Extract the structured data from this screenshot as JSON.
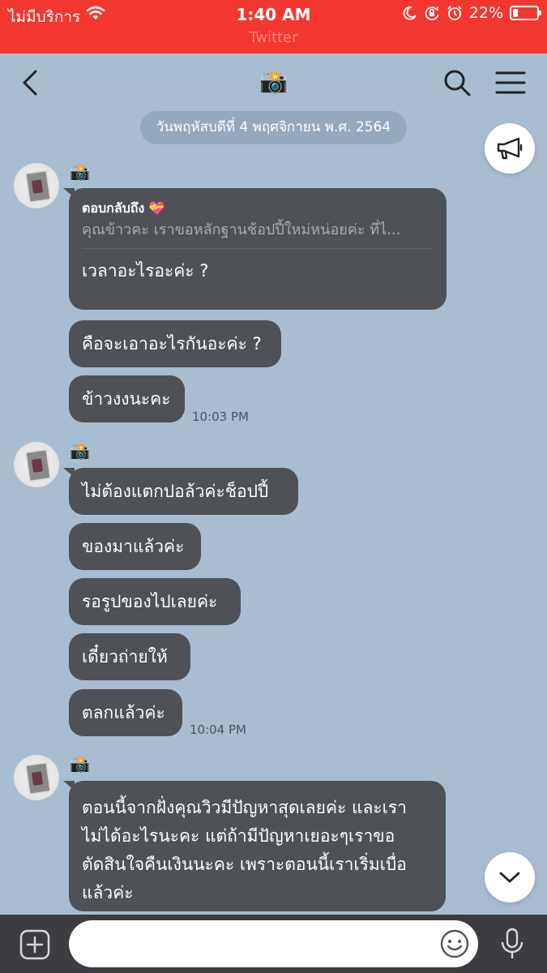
{
  "status_bar": {
    "carrier": "ไม่มีบริการ",
    "time": "1:40 AM",
    "battery_percent": "22%",
    "battery_level": 0.22,
    "back_to_app": "Twitter",
    "icons": [
      "wifi-icon",
      "moon-icon",
      "orientation-lock-icon",
      "alarm-icon",
      "battery-icon"
    ]
  },
  "header": {
    "title": "📸",
    "icons": [
      "back-chevron-icon",
      "search-icon",
      "menu-icon"
    ]
  },
  "date_divider": "วันพฤหัสบดีที่ 4 พฤศจิกายน พ.ศ. 2564",
  "groups": [
    {
      "sender": "📸",
      "reply": {
        "label": "ตอบกลับถึง 💝",
        "quote": "คุณข้าวคะ เราขอหลักฐานช้อปปี้ใหม่หน่อยค่ะ ที่ไ..."
      },
      "messages": [
        "เวลาอะไรอะค่ะ ?",
        "คือจะเอาอะไรกันอะค่ะ ?",
        "ข้าวงงนะคะ"
      ],
      "time": "10:03 PM"
    },
    {
      "sender": "📸",
      "messages": [
        "ไม่ต้องแตกปอล้วค่ะช็อปปี้",
        "ของมาแล้วค่ะ",
        "รอรูปของไปเลยค่ะ",
        "เดี๋ยวถ่ายให้",
        "ตลกแล้วค่ะ"
      ],
      "time": "10:04 PM"
    },
    {
      "sender": "📸",
      "messages": [
        "ตอนนี้จากฝั่งคุณวิวมีปัญหาสุดเลยค่ะ และเรา",
        "ไม่ได้อะไรนะคะ แต่ถ้ามีปัญหาเยอะๆเราขอ",
        "ตัดสินใจคืนเงินนะคะ เพราะตอนนี้เราเริ่มเบื่อ",
        "แล้วค่ะ"
      ]
    }
  ],
  "input": {
    "placeholder": "",
    "icons": [
      "plus-icon",
      "emoji-icon",
      "microphone-icon"
    ]
  },
  "colors": {
    "status_bar": "#f2372f",
    "chat_background": "#a9bdd0",
    "bubble": "#4e5156",
    "input_bar": "#3b3d40"
  }
}
